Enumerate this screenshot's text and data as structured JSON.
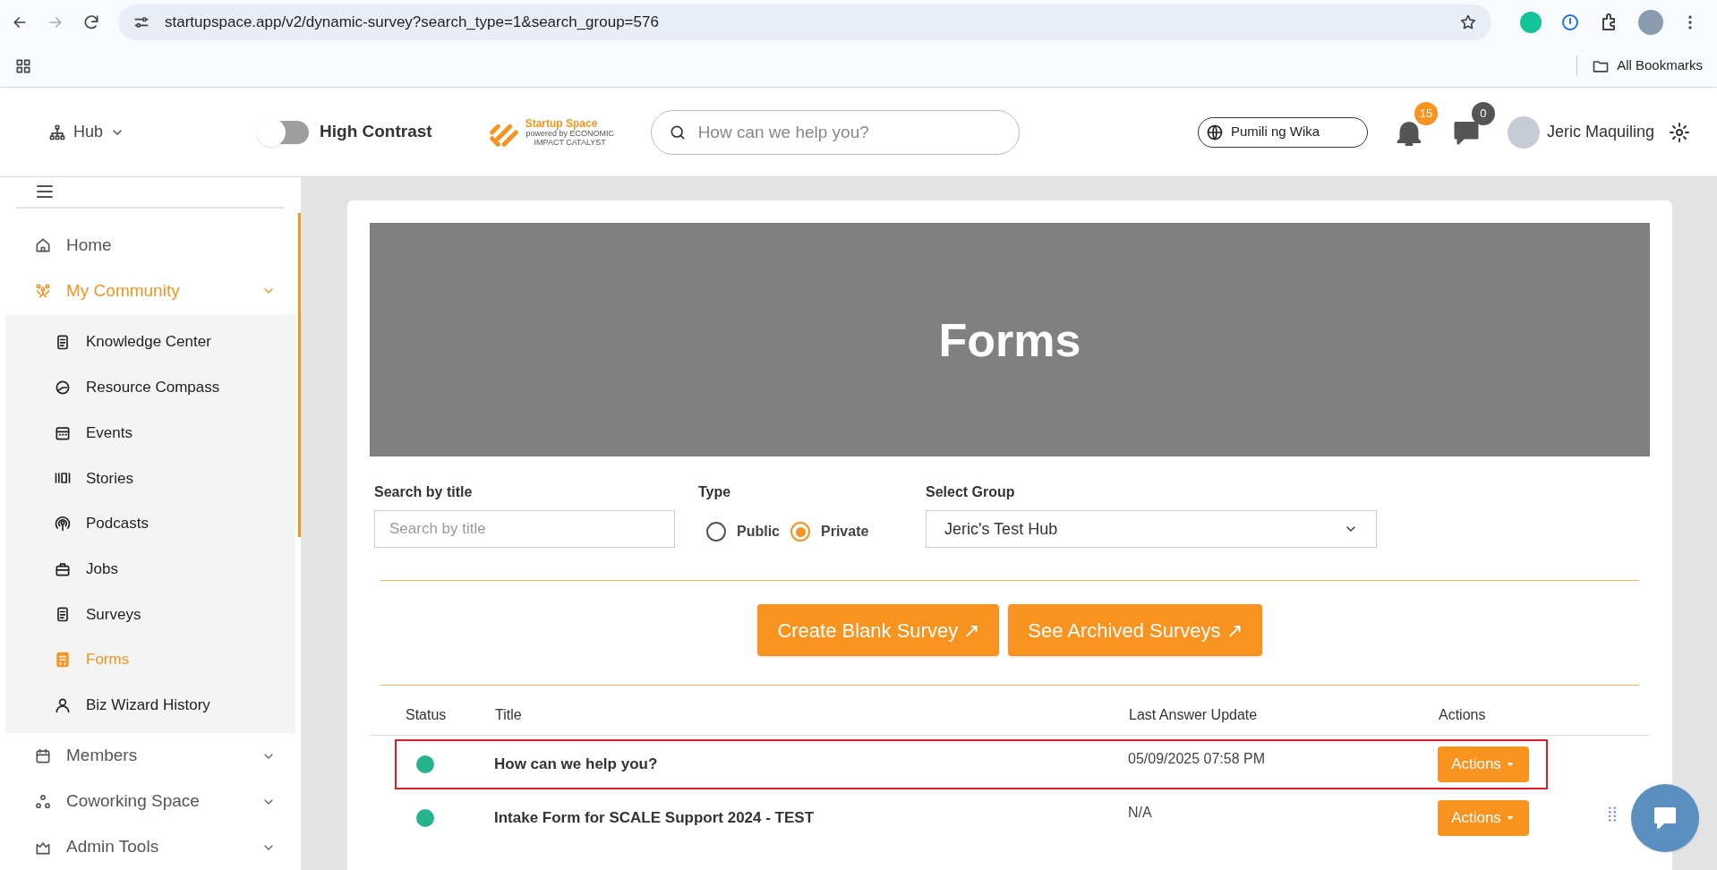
{
  "browser": {
    "url": "startupspace.app/v2/dynamic-survey?search_type=1&search_group=576",
    "bookmarks_label": "All Bookmarks"
  },
  "header": {
    "hub": "Hub",
    "high_contrast": {
      "label": "High Contrast",
      "on": false
    },
    "logo": {
      "name": "Startup Space",
      "tagline": "powered by ECONOMIC IMPACT CATALYST"
    },
    "search": {
      "placeholder": "How can we help you?"
    },
    "language": "Pumili ng Wika",
    "notifications": "15",
    "messages": "0",
    "user": "Jeric Maquiling"
  },
  "sidebar": {
    "items": [
      {
        "label": "Home",
        "selected": false
      },
      {
        "label": "My Community",
        "selected": true,
        "expanded": true,
        "children": [
          {
            "label": "Knowledge Center",
            "selected": false
          },
          {
            "label": "Resource Compass",
            "selected": false
          },
          {
            "label": "Events",
            "selected": false
          },
          {
            "label": "Stories",
            "selected": false
          },
          {
            "label": "Podcasts",
            "selected": false
          },
          {
            "label": "Jobs",
            "selected": false
          },
          {
            "label": "Surveys",
            "selected": false
          },
          {
            "label": "Forms",
            "selected": true
          },
          {
            "label": "Biz Wizard History",
            "selected": false
          }
        ]
      },
      {
        "label": "Members",
        "selected": false,
        "expanded": false
      },
      {
        "label": "Coworking Space",
        "selected": false,
        "expanded": false
      },
      {
        "label": "Admin Tools",
        "selected": false,
        "expanded": false
      }
    ]
  },
  "page": {
    "title": "Forms",
    "search": {
      "label": "Search by title",
      "placeholder": "Search by title"
    },
    "type": {
      "label": "Type",
      "options": [
        {
          "label": "Public",
          "selected": false
        },
        {
          "label": "Private",
          "selected": true
        }
      ]
    },
    "group": {
      "label": "Select Group",
      "value": "Jeric's Test Hub"
    },
    "buttons": [
      "Create Blank Survey ↗",
      "See Archived Surveys ↗"
    ],
    "table": {
      "columns": [
        "Status",
        "Title",
        "Last Answer Update",
        "Actions"
      ],
      "rows": [
        {
          "color": "#26b48f",
          "title": "How can we help you?",
          "updated": "05/09/2025 07:58 PM",
          "action": "Actions",
          "highlighted": true
        },
        {
          "color": "#26b48f",
          "title": "Intake Form for SCALE Support 2024 - TEST",
          "updated": "N/A",
          "action": "Actions",
          "highlighted": false
        }
      ]
    }
  }
}
